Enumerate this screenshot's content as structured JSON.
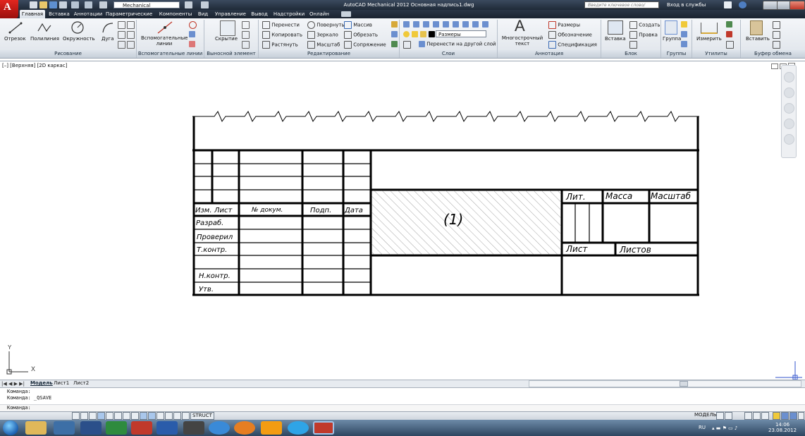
{
  "window": {
    "workspace": "Mechanical",
    "title": "AutoCAD Mechanical 2012   Основная надпись1.dwg",
    "search_placeholder": "Введите ключевое слово/фразу",
    "signin": "Вход в службы"
  },
  "tabs": [
    "Главная",
    "Вставка",
    "Аннотации",
    "Параметрические",
    "Компоненты",
    "Вид",
    "Управление",
    "Вывод",
    "Надстройки",
    "Онлайн"
  ],
  "ribbon": {
    "draw": {
      "line": "Отрезок",
      "polyline": "Полилиния",
      "circle": "Окружность",
      "arc": "Дуга"
    },
    "constr": {
      "construction_lines": "Вспомогательные линии"
    },
    "detail": {
      "hide": "Скрытие"
    },
    "modify": {
      "move": "Перенести",
      "rotate": "Повернуть",
      "array": "Массив",
      "copy": "Копировать",
      "mirror": "Зеркало",
      "trim": "Обрезать",
      "stretch": "Растянуть",
      "scale": "Масштаб",
      "fillet": "Сопряжение"
    },
    "layers": {
      "current_layer": "Размеры",
      "move_to_layer": "Перенести на другой слой"
    },
    "annotation": {
      "mtext": "Многострочный текст",
      "dimensions": "Размеры",
      "symbols": "Обозначение",
      "specification": "Спецификация"
    },
    "block": {
      "insert": "Вставка",
      "create": "Создать",
      "edit": "Правка"
    },
    "groups": {
      "group": "Группа"
    },
    "utilities": {
      "measure": "Измерить"
    },
    "clipboard": {
      "paste": "Вставить"
    },
    "panels": [
      "Рисование",
      "Вспомогательные линии",
      "Выносной элемент",
      "Редактирование",
      "Слои",
      "Аннотация",
      "Блок",
      "Группы",
      "Утилиты",
      "Буфер обмена"
    ]
  },
  "viewport": {
    "label": "[–] [Верхняя] [2D каркас]"
  },
  "ucs": {
    "x": "X",
    "y": "Y"
  },
  "title_block": {
    "rev_headers": [
      "Изм.",
      "Лист",
      "№ докум.",
      "Подп.",
      "Дата"
    ],
    "roles": [
      "Разраб.",
      "Проверил",
      "Т.контр.",
      "",
      "Н.контр.",
      "Утв."
    ],
    "lit": "Лит.",
    "mass": "Масса",
    "scale": "Масштаб",
    "sheet": "Лист",
    "sheets": "Листов",
    "placeholder": "(1)"
  },
  "layout_tabs": [
    "Модель",
    "Лист1",
    "Лист2"
  ],
  "command": {
    "line1": "Команда:",
    "line2": "Команда: _QSAVE",
    "prompt": "Команда:"
  },
  "status": {
    "struct": "STRUCT",
    "model": "МОДЕЛЬ"
  },
  "taskbar": {
    "lang": "RU",
    "time": "14:06",
    "date": "23.08.2012"
  }
}
